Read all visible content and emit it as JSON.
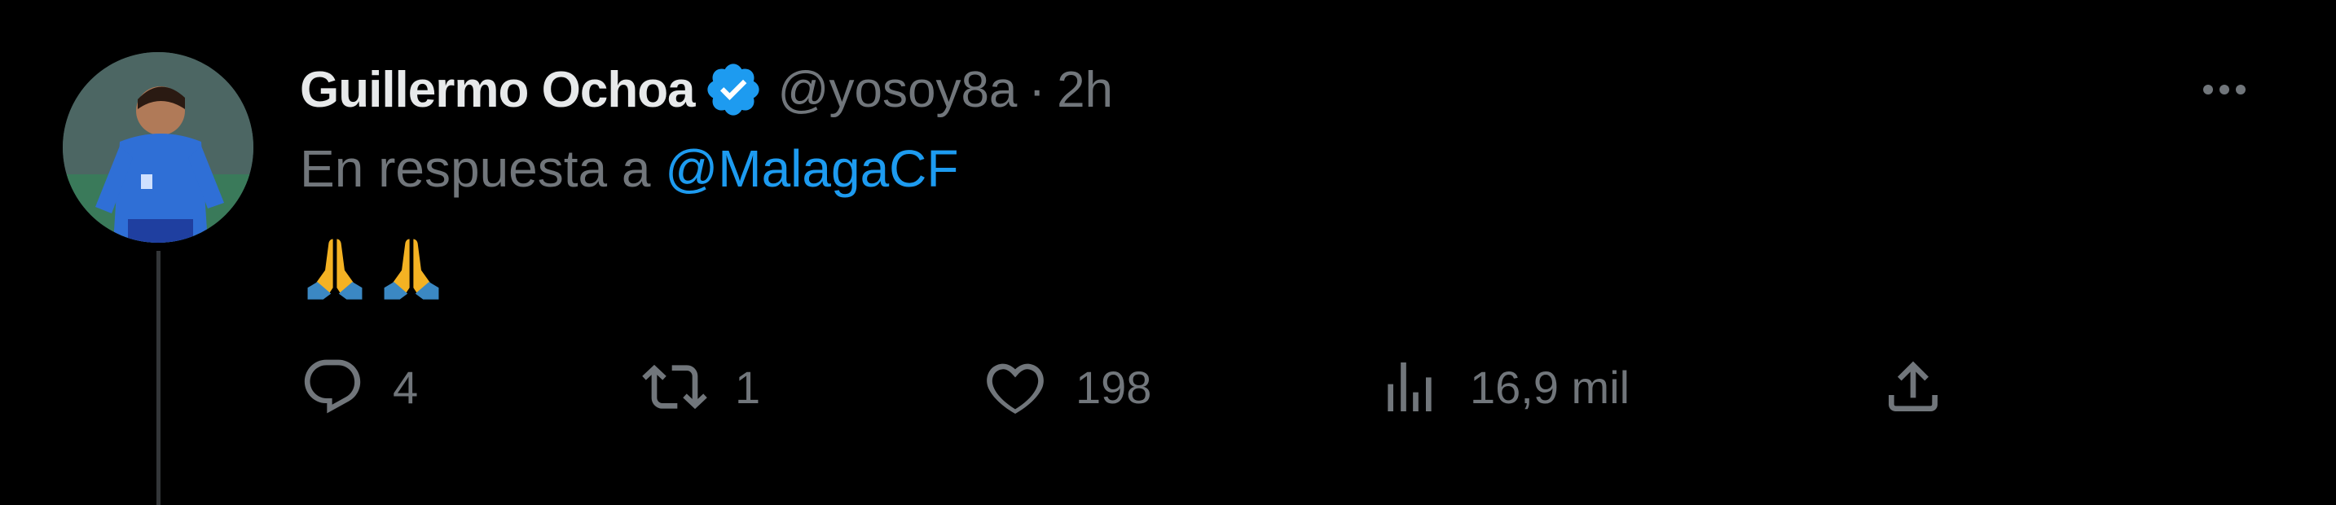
{
  "author": {
    "name": "Guillermo Ochoa",
    "handle": "@yosoy8a",
    "separator": "·",
    "time": "2h",
    "verified": true
  },
  "reply": {
    "prefix": "En respuesta a ",
    "mention": "@MalagaCF"
  },
  "tweet": {
    "emojis": [
      "folded-hands",
      "folded-hands"
    ]
  },
  "actions": {
    "replies": "4",
    "retweets": "1",
    "likes": "198",
    "views": "16,9 mil"
  },
  "colors": {
    "background": "#000000",
    "accent": "#1d9bf0",
    "muted": "#71767b",
    "text": "#e7e9ea"
  }
}
